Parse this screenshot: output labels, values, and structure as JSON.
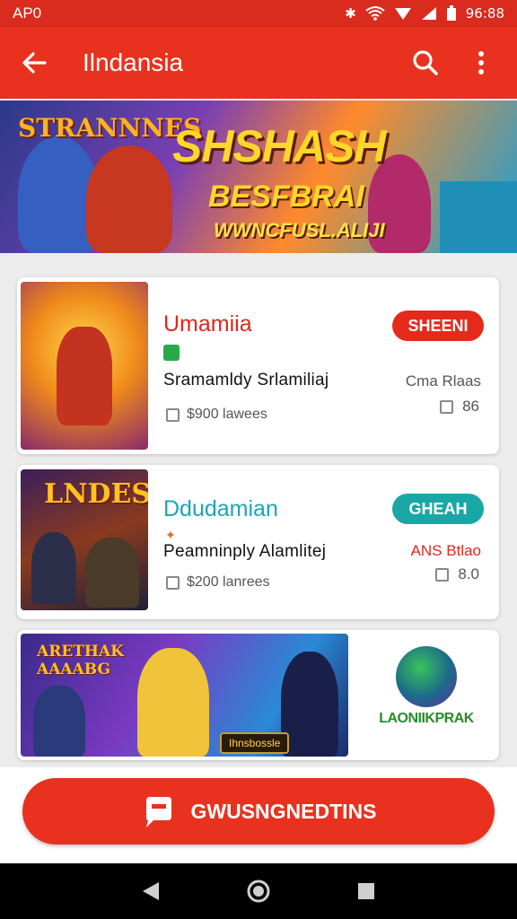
{
  "status_bar": {
    "left": "AP0",
    "time": "96:88"
  },
  "app_bar": {
    "title": "Ilndansia"
  },
  "banner": {
    "logo": "STRANNNES",
    "headline": "SHSHASH",
    "subline": "BESFBRAI",
    "tagline": "WWNCFUSL.ALIJI"
  },
  "cards": [
    {
      "thumb_text": "",
      "title": "Umamiia",
      "title_color": "#e0271a",
      "subtitle": "Sramamldy Srlamiliaj",
      "meta": "$900 lawees",
      "pill": "SHEENI",
      "pill_color": "#e52a1c",
      "right_text": "Cma Rlaas",
      "right_meta": "86"
    },
    {
      "thumb_text": "LNDES",
      "title": "Ddudamian",
      "title_color": "#1aa6b5",
      "subtitle": "Peamninply Alamlitej",
      "meta": "$200 lanrees",
      "pill": "GHEAH",
      "pill_color": "#19a7a6",
      "right_text": "ANS Btlao",
      "right_meta": "8.0"
    }
  ],
  "wide_card": {
    "banner_text": "ARETHAK AAAABG",
    "banner_badge": "Ihnsbossle",
    "side_brand": "LAONIIKPRAK"
  },
  "cta": {
    "label": "GWUSNGNEDTINS"
  }
}
